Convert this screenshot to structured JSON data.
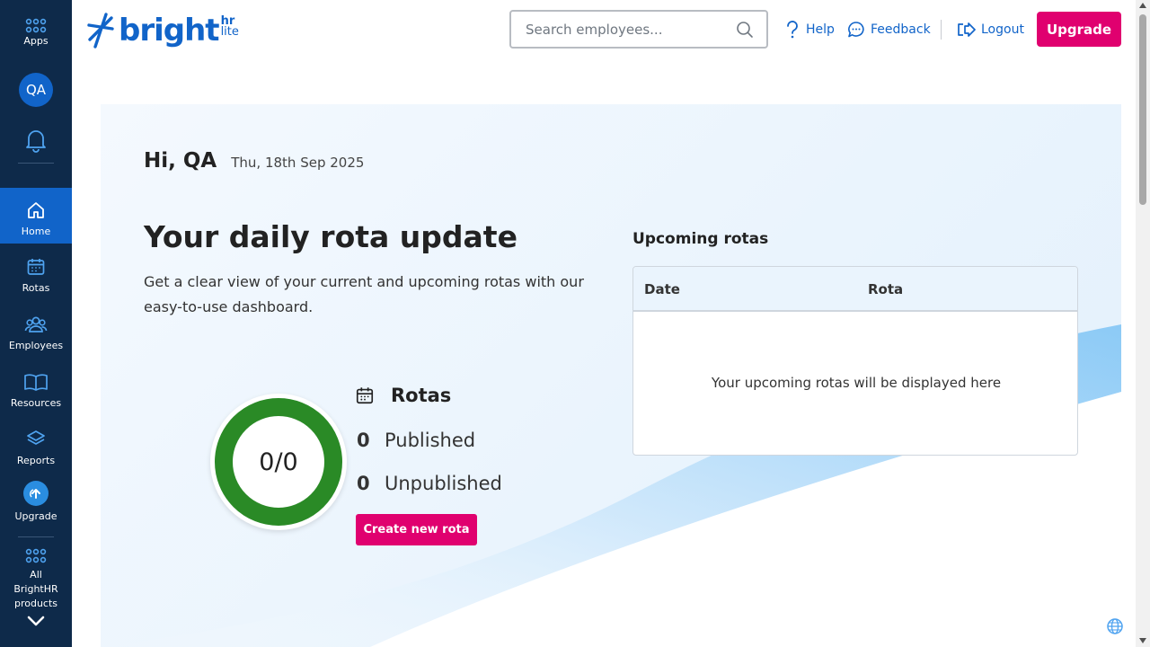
{
  "sidebar": {
    "apps_label": "Apps",
    "avatar_initials": "QA",
    "items": [
      {
        "label": "Home",
        "icon": "home-icon",
        "active": true
      },
      {
        "label": "Rotas",
        "icon": "calendar-icon"
      },
      {
        "label": "Employees",
        "icon": "people-icon"
      },
      {
        "label": "Resources",
        "icon": "book-icon"
      },
      {
        "label": "Reports",
        "icon": "layers-icon"
      },
      {
        "label": "Upgrade",
        "icon": "upgrade-arrow-icon"
      }
    ],
    "all_products_label": "All BrightHR products"
  },
  "header": {
    "logo": {
      "word": "bright",
      "hr": "hr",
      "lite": "lite"
    },
    "search_placeholder": "Search employees...",
    "help_label": "Help",
    "feedback_label": "Feedback",
    "logout_label": "Logout",
    "upgrade_label": "Upgrade"
  },
  "main": {
    "greeting": "Hi, QA",
    "date": "Thu, 18th Sep 2025",
    "title": "Your daily rota update",
    "description": "Get a clear view of your current and upcoming rotas with our easy-to-use dashboard.",
    "ring_text": "0/0",
    "rotas_heading": "Rotas",
    "published_count": "0",
    "published_label": "Published",
    "unpublished_count": "0",
    "unpublished_label": "Unpublished",
    "create_button": "Create new rota",
    "upcoming": {
      "title": "Upcoming rotas",
      "columns": [
        "Date",
        "Rota"
      ],
      "empty_message": "Your upcoming rotas will be displayed here"
    }
  },
  "colors": {
    "sidebar_bg": "#0e2a4a",
    "brand_blue": "#1164c9",
    "accent_pink": "#e0006f",
    "ring_green": "#2a8a26"
  }
}
